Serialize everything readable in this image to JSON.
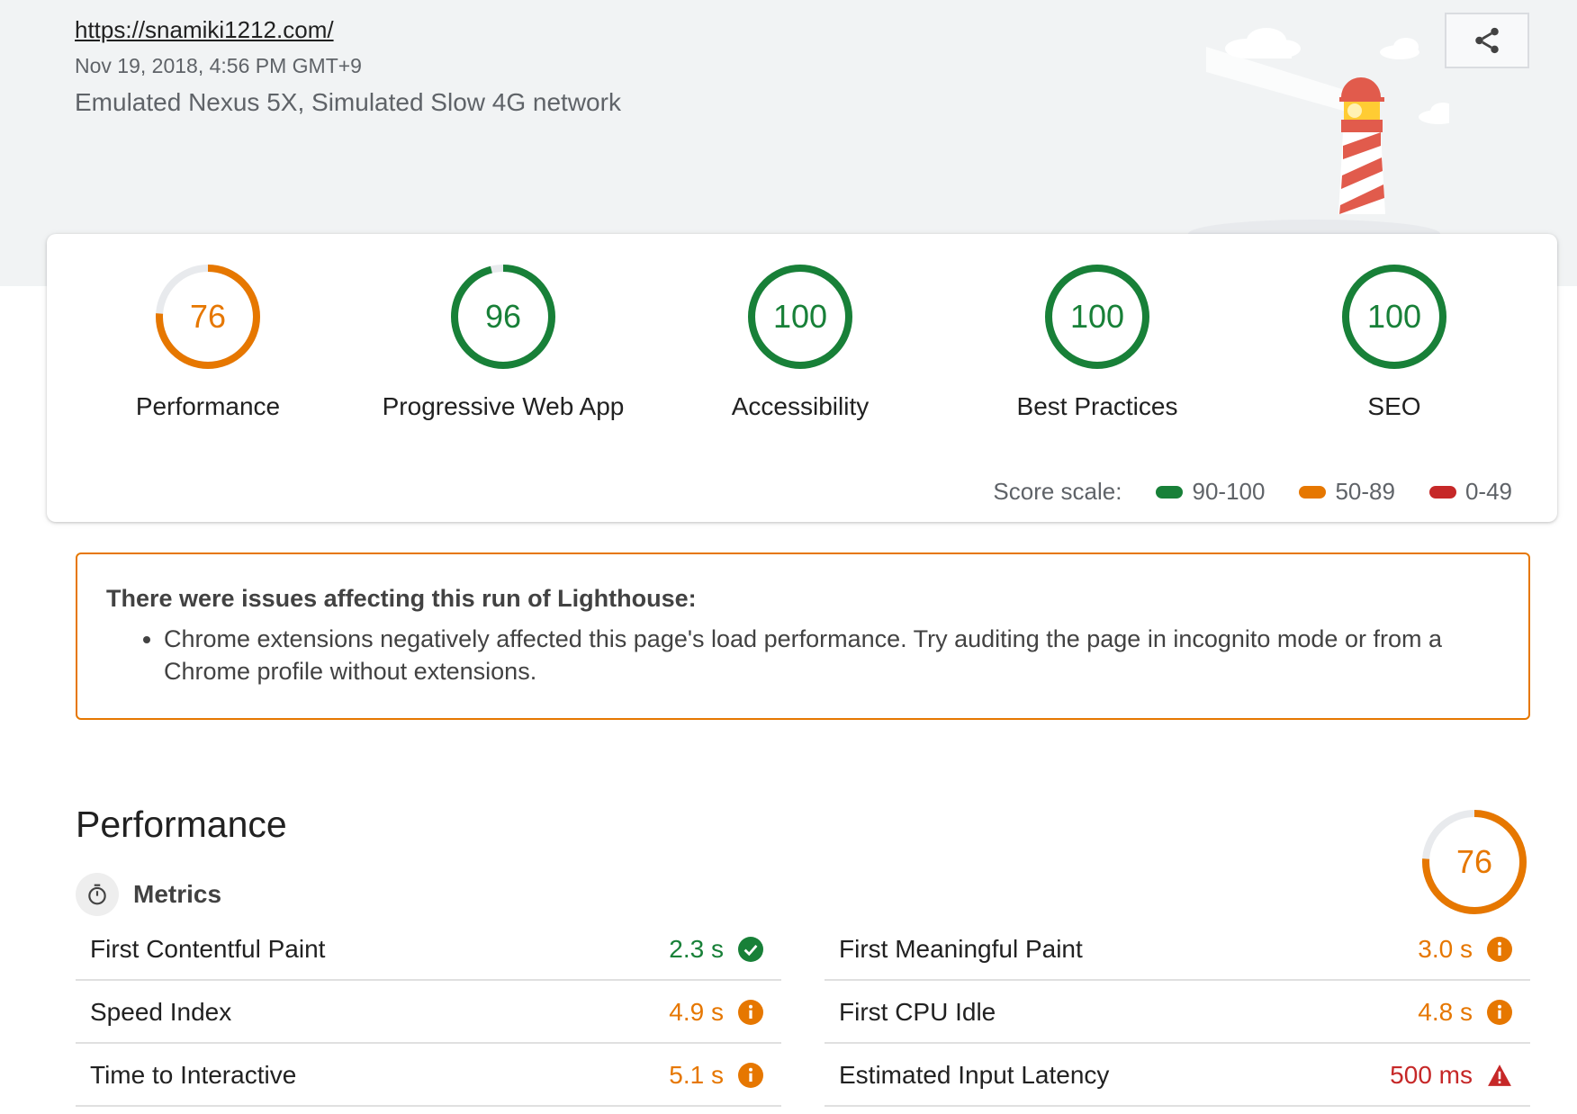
{
  "header": {
    "url": "https://snamiki1212.com/",
    "timestamp": "Nov 19, 2018, 4:56 PM GMT+9",
    "environment": "Emulated Nexus 5X, Simulated Slow 4G network",
    "share_icon": "share-icon",
    "illustration": "lighthouse-illustration"
  },
  "colors": {
    "pass": "#188038",
    "average": "#e67700",
    "fail": "#c62828",
    "header_bg": "#f1f3f4"
  },
  "gauges": [
    {
      "score": "76",
      "label": "Performance",
      "fraction": 0.76,
      "color": "#e67700"
    },
    {
      "score": "96",
      "label": "Progressive Web App",
      "fraction": 0.96,
      "color": "#188038"
    },
    {
      "score": "100",
      "label": "Accessibility",
      "fraction": 1.0,
      "color": "#188038"
    },
    {
      "score": "100",
      "label": "Best Practices",
      "fraction": 1.0,
      "color": "#188038"
    },
    {
      "score": "100",
      "label": "SEO",
      "fraction": 1.0,
      "color": "#188038"
    }
  ],
  "score_scale": {
    "label": "Score scale:",
    "ranges": [
      {
        "label": "90-100",
        "color": "#188038"
      },
      {
        "label": "50-89",
        "color": "#e67700"
      },
      {
        "label": "0-49",
        "color": "#c62828"
      }
    ]
  },
  "warning": {
    "title": "There were issues affecting this run of Lighthouse:",
    "items": [
      "Chrome extensions negatively affected this page's load performance. Try auditing the page in incognito mode or from a Chrome profile without extensions."
    ]
  },
  "performance": {
    "title": "Performance",
    "score": "76",
    "fraction": 0.76,
    "metrics_label": "Metrics",
    "metrics_icon": "stopwatch-icon",
    "metrics": [
      {
        "name": "First Contentful Paint",
        "value": "2.3 s",
        "status": "pass",
        "icon": "check-circle-icon"
      },
      {
        "name": "First Meaningful Paint",
        "value": "3.0 s",
        "status": "average",
        "icon": "info-icon"
      },
      {
        "name": "Speed Index",
        "value": "4.9 s",
        "status": "average",
        "icon": "info-icon"
      },
      {
        "name": "First CPU Idle",
        "value": "4.8 s",
        "status": "average",
        "icon": "info-icon"
      },
      {
        "name": "Time to Interactive",
        "value": "5.1 s",
        "status": "average",
        "icon": "info-icon"
      },
      {
        "name": "Estimated Input Latency",
        "value": "500 ms",
        "status": "fail",
        "icon": "warning-icon"
      }
    ]
  }
}
